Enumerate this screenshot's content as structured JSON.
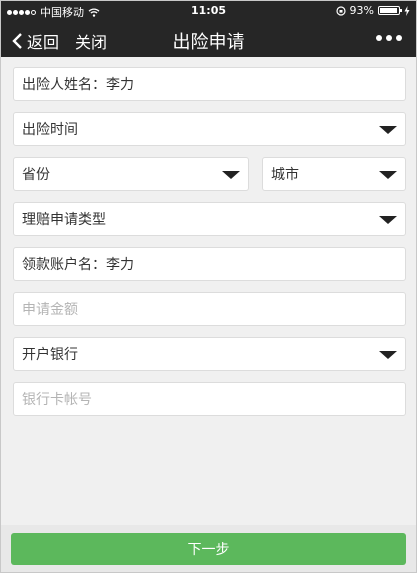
{
  "status_bar": {
    "carrier": "中国移动",
    "time": "11:05",
    "battery_percent": "93%",
    "battery_level": 0.93,
    "icons": [
      "signal-dots-icon",
      "wifi-icon",
      "rotation-lock-icon",
      "battery-icon",
      "charging-icon"
    ]
  },
  "nav": {
    "back_label": "返回",
    "close_label": "关闭",
    "title": "出险申请",
    "icons": [
      "chevron-left-icon",
      "more-icon"
    ]
  },
  "form": {
    "insured_name": "出险人姓名：李力",
    "incident_time": "出险时间",
    "province": "省份",
    "city": "城市",
    "claim_type": "理赔申请类型",
    "payee_account_name": "领款账户名：李力",
    "claim_amount_placeholder": "申请金额",
    "bank": "开户银行",
    "card_number_placeholder": "银行卡帐号"
  },
  "footer": {
    "next_label": "下一步"
  },
  "colors": {
    "bar_background": "#262626",
    "page_background": "#f0f0f0",
    "primary_button": "#5cb85c",
    "placeholder_text": "#b4b4b4"
  }
}
